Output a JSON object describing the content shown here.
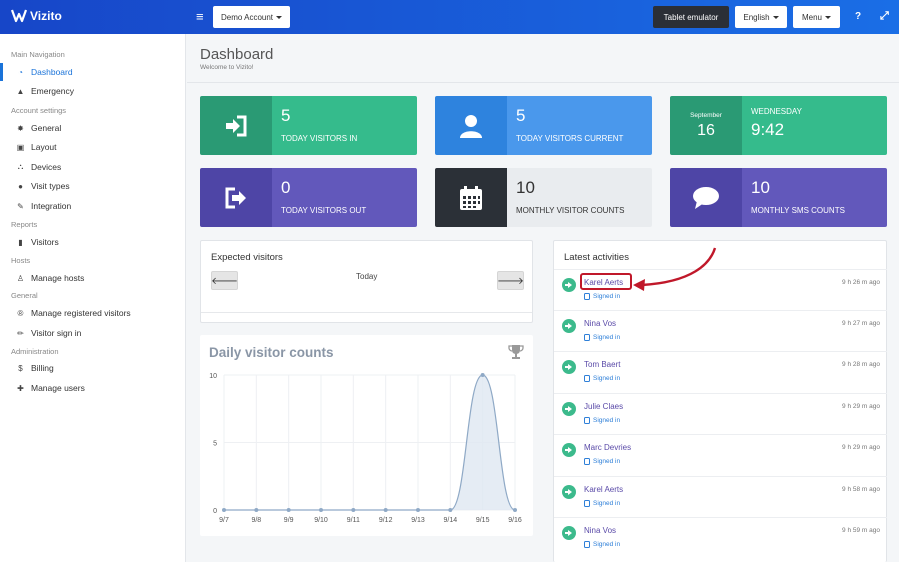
{
  "app": {
    "brand": "Vizito"
  },
  "topbar": {
    "account_label": "Demo Account",
    "tablet_label": "Tablet emulator",
    "language_label": "English",
    "menu_label": "Menu",
    "help_label": "?",
    "expand_label": "⤢"
  },
  "sidebar": {
    "sections": [
      {
        "title": "Main Navigation",
        "items": [
          {
            "label": "Dashboard",
            "icon": "dashboard-gauge-icon",
            "active": true
          },
          {
            "label": "Emergency",
            "icon": "warning-icon"
          }
        ]
      },
      {
        "title": "Account settings",
        "items": [
          {
            "label": "General",
            "icon": "gear-icon"
          },
          {
            "label": "Layout",
            "icon": "image-icon"
          },
          {
            "label": "Devices",
            "icon": "sitemap-icon"
          },
          {
            "label": "Visit types",
            "icon": "users-icon"
          },
          {
            "label": "Integration",
            "icon": "plug-icon"
          }
        ]
      },
      {
        "title": "Reports",
        "items": [
          {
            "label": "Visitors",
            "icon": "book-icon"
          }
        ]
      },
      {
        "title": "Hosts",
        "items": [
          {
            "label": "Manage hosts",
            "icon": "person-icon"
          }
        ]
      },
      {
        "title": "General",
        "items": [
          {
            "label": "Manage registered visitors",
            "icon": "registered-icon"
          },
          {
            "label": "Visitor sign in",
            "icon": "pencil-icon"
          }
        ]
      },
      {
        "title": "Administration",
        "items": [
          {
            "label": "Billing",
            "icon": "dollar-icon"
          },
          {
            "label": "Manage users",
            "icon": "user-plus-icon"
          }
        ]
      }
    ]
  },
  "header": {
    "title": "Dashboard",
    "subtitle": "Welcome to Vizito!"
  },
  "tiles": [
    {
      "value": "5",
      "label": "TODAY VISITORS IN",
      "icon": "sign-in-icon",
      "icon_bg": "#2a9a74",
      "bg": "#35bb8c"
    },
    {
      "value": "5",
      "label": "TODAY VISITORS CURRENT",
      "icon": "user-icon",
      "icon_bg": "#2e83de",
      "bg": "#4a98ec"
    },
    {
      "month": "September",
      "day": "16",
      "value": "9:42",
      "label": "WEDNESDAY",
      "icon_bg": "#2a9a74",
      "bg": "#35bb8c"
    },
    {
      "value": "0",
      "label": "TODAY VISITORS OUT",
      "icon": "sign-out-icon",
      "icon_bg": "#4e45a6",
      "bg": "#6258bb"
    },
    {
      "value": "10",
      "label": "MONTHLY VISITOR COUNTS",
      "icon": "calendar-icon",
      "icon_bg": "#2b3037",
      "bg": "#e9ecef"
    },
    {
      "value": "10",
      "label": "MONTHLY SMS COUNTS",
      "icon": "comment-icon",
      "icon_bg": "#4e45a6",
      "bg": "#6258bb"
    }
  ],
  "expected": {
    "title": "Expected visitors",
    "date_label": "Today",
    "prev": "🡐",
    "next": "🡒"
  },
  "chart": {
    "title": "Daily visitor counts",
    "trophy_icon": "trophy-icon"
  },
  "chart_data": {
    "type": "area",
    "categories": [
      "9/7",
      "9/8",
      "9/9",
      "9/10",
      "9/11",
      "9/12",
      "9/13",
      "9/14",
      "9/15",
      "9/16"
    ],
    "values": [
      0,
      0,
      0,
      0,
      0,
      0,
      0,
      0,
      10,
      0
    ],
    "yticks": [
      "0",
      "5",
      "10"
    ],
    "ylim": [
      0,
      10
    ],
    "grid": true,
    "color": "#8fa9c6"
  },
  "activities": {
    "title": "Latest activities",
    "items": [
      {
        "name": "Karel Aerts",
        "status": "Signed in",
        "time": "9 h 26 m ago",
        "highlighted": true
      },
      {
        "name": "Nina Vos",
        "status": "Signed in",
        "time": "9 h 27 m ago"
      },
      {
        "name": "Tom Baert",
        "status": "Signed in",
        "time": "9 h 28 m ago"
      },
      {
        "name": "Julie Claes",
        "status": "Signed in",
        "time": "9 h 29 m ago"
      },
      {
        "name": "Marc Devries",
        "status": "Signed in",
        "time": "9 h 29 m ago"
      },
      {
        "name": "Karel Aerts",
        "status": "Signed in",
        "time": "9 h 58 m ago"
      },
      {
        "name": "Nina Vos",
        "status": "Signed in",
        "time": "9 h 59 m ago"
      }
    ]
  },
  "colors": {
    "accent": "#1a73d9",
    "highlight": "#c0182a"
  }
}
